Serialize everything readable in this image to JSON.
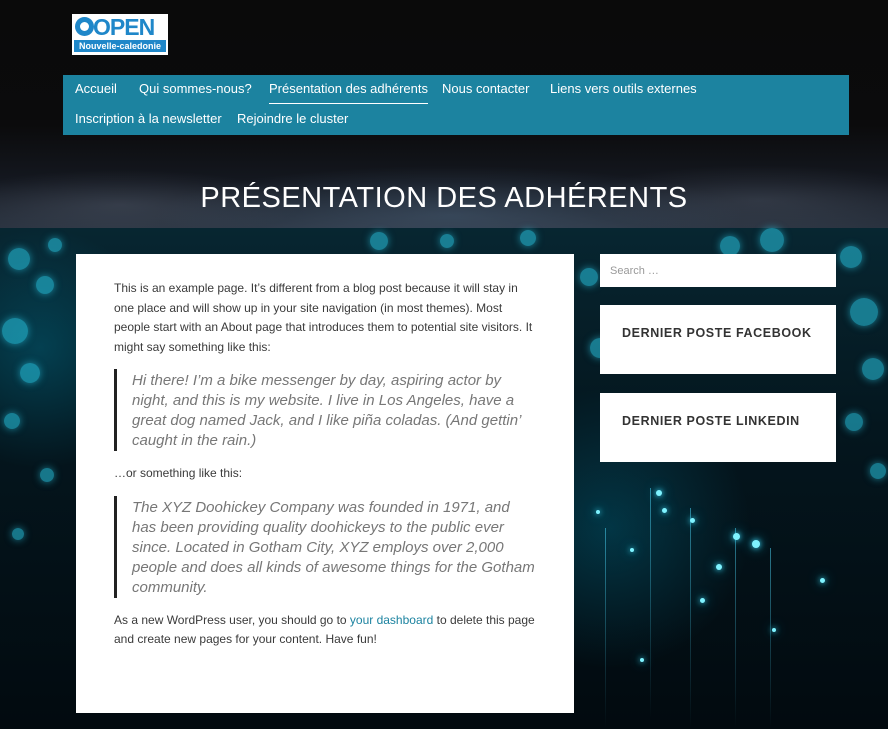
{
  "logo": {
    "word": "OPEN",
    "subtitle": "Nouvelle-caledonie"
  },
  "nav": {
    "items": [
      {
        "label": "Accueil"
      },
      {
        "label": "Qui sommes-nous?"
      },
      {
        "label": "Présentation des adhérents"
      },
      {
        "label": "Nous contacter"
      },
      {
        "label": "Liens vers outils externes"
      },
      {
        "label": "Inscription à la newsletter"
      },
      {
        "label": "Rejoindre le cluster"
      }
    ],
    "active_index": 2
  },
  "page": {
    "title": "PRÉSENTATION DES ADHÉRENTS"
  },
  "content": {
    "intro": "This is an example page. It’s different from a blog post because it will stay in one place and will show up in your site navigation (in most themes). Most people start with an About page that introduces them to potential site visitors. It might say something like this:",
    "quote1": "Hi there! I’m a bike messenger by day, aspiring actor by night, and this is my website. I live in Los Angeles, have a great dog named Jack, and I like piña coladas. (And gettin’ caught in the rain.)",
    "middle": "…or something like this:",
    "quote2": "The XYZ Doohickey Company was founded in 1971, and has been providing quality doohickeys to the public ever since. Located in Gotham City, XYZ employs over 2,000 people and does all kinds of awesome things for the Gotham community.",
    "outro_before": "As a new WordPress user, you should go to ",
    "outro_link": "your dashboard",
    "outro_after": " to delete this page and create new pages for your content. Have fun!"
  },
  "sidebar": {
    "search_placeholder": "Search …",
    "widgets": [
      {
        "title": "DERNIER POSTE FACEBOOK"
      },
      {
        "title": "DERNIER POSTE LINKEDIN"
      }
    ]
  },
  "colors": {
    "nav_bg": "#1c83a0",
    "brand_blue": "#1f87c9",
    "link": "#1c83a0"
  }
}
